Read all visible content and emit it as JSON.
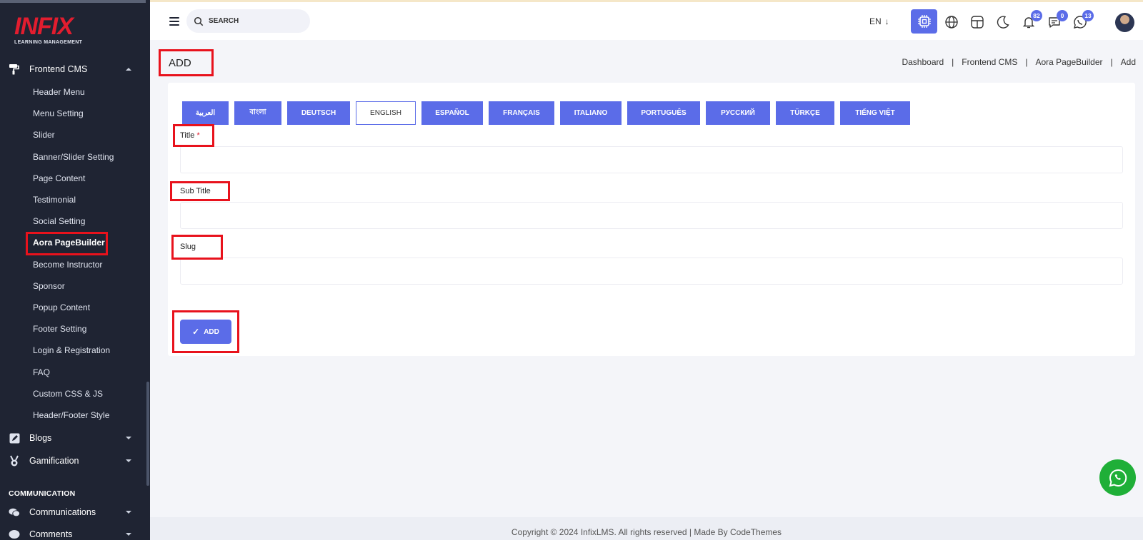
{
  "brand": {
    "logo": "INFIX",
    "tagline": "LEARNING MANAGEMENT"
  },
  "sidebar": {
    "frontend_cms": "Frontend CMS",
    "sub_items": [
      "Header Menu",
      "Menu Setting",
      "Slider",
      "Banner/Slider Setting",
      "Page Content",
      "Testimonial",
      "Social Setting",
      "Aora PageBuilder",
      "Become Instructor",
      "Sponsor",
      "Popup Content",
      "Footer Setting",
      "Login & Registration",
      "FAQ",
      "Custom CSS & JS",
      "Header/Footer Style"
    ],
    "active_item": "Aora PageBuilder",
    "blogs": "Blogs",
    "gamification": "Gamification",
    "section_communication": "COMMUNICATION",
    "communications": "Communications",
    "comments": "Comments"
  },
  "topbar": {
    "search_placeholder": "SEARCH",
    "language": "EN",
    "notifications_count": "82",
    "messages_count": "0",
    "whatsapp_count": "13"
  },
  "page": {
    "title": "ADD",
    "breadcrumb": [
      "Dashboard",
      "Frontend CMS",
      "Aora PageBuilder",
      "Add"
    ]
  },
  "languages": [
    "العربية",
    "বাংলা",
    "DEUTSCH",
    "ENGLISH",
    "ESPAÑOL",
    "FRANÇAIS",
    "ITALIANO",
    "PORTUGUÊS",
    "РУССКИЙ",
    "TÜRKÇE",
    "TIẾNG VIỆT"
  ],
  "active_language": "ENGLISH",
  "form": {
    "title_label": "Title",
    "required_mark": "*",
    "title_value": "",
    "subtitle_label": "Sub Title",
    "subtitle_value": "",
    "slug_label": "Slug",
    "slug_value": "",
    "submit_label": "ADD",
    "submit_check": "✓"
  },
  "footer": {
    "copyright": "Copyright © 2024 InfixLMS. All rights reserved | Made By CodeThemes"
  },
  "colors": {
    "primary": "#5b6ce8",
    "sidebar_bg": "#1f2433",
    "highlight": "#e8121c",
    "whatsapp": "#1faf38"
  }
}
